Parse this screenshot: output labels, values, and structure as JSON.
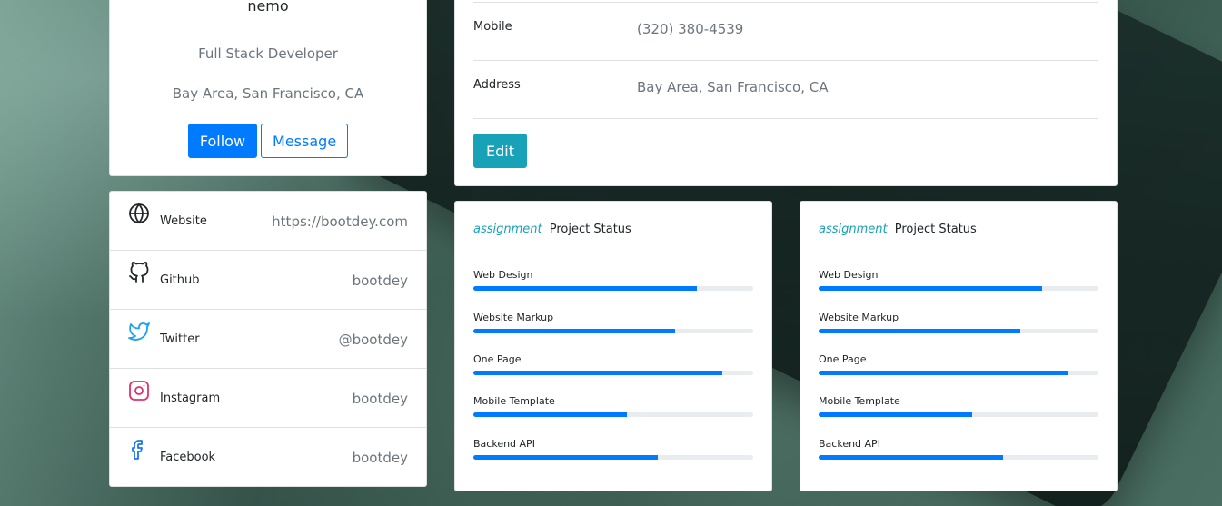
{
  "profile": {
    "name": "nemo",
    "role": "Full Stack Developer",
    "location": "Bay Area, San Francisco, CA",
    "follow_label": "Follow",
    "message_label": "Message"
  },
  "social": [
    {
      "icon": "globe-icon",
      "label": "Website",
      "value": "https://bootdey.com"
    },
    {
      "icon": "github-icon",
      "label": "Github",
      "value": "bootdey"
    },
    {
      "icon": "twitter-icon",
      "label": "Twitter",
      "value": "@bootdey"
    },
    {
      "icon": "instagram-icon",
      "label": "Instagram",
      "value": "bootdey"
    },
    {
      "icon": "facebook-icon",
      "label": "Facebook",
      "value": "bootdey"
    }
  ],
  "details": {
    "mobile_label": "Mobile",
    "mobile_value": "(320) 380-4539",
    "address_label": "Address",
    "address_value": "Bay Area, San Francisco, CA",
    "edit_label": "Edit"
  },
  "projects": [
    {
      "tag": "assignment",
      "title": "Project Status",
      "items": [
        {
          "label": "Web Design",
          "percent": 80
        },
        {
          "label": "Website Markup",
          "percent": 72
        },
        {
          "label": "One Page",
          "percent": 89
        },
        {
          "label": "Mobile Template",
          "percent": 55
        },
        {
          "label": "Backend API",
          "percent": 66
        }
      ]
    },
    {
      "tag": "assignment",
      "title": "Project Status",
      "items": [
        {
          "label": "Web Design",
          "percent": 80
        },
        {
          "label": "Website Markup",
          "percent": 72
        },
        {
          "label": "One Page",
          "percent": 89
        },
        {
          "label": "Mobile Template",
          "percent": 55
        },
        {
          "label": "Backend API",
          "percent": 66
        }
      ]
    }
  ],
  "colors": {
    "primary": "#007bff",
    "info": "#17a2b8",
    "muted": "#6c757d",
    "twitter": "#1da1f2",
    "instagram": "#e1306c",
    "facebook": "#1877f2"
  }
}
